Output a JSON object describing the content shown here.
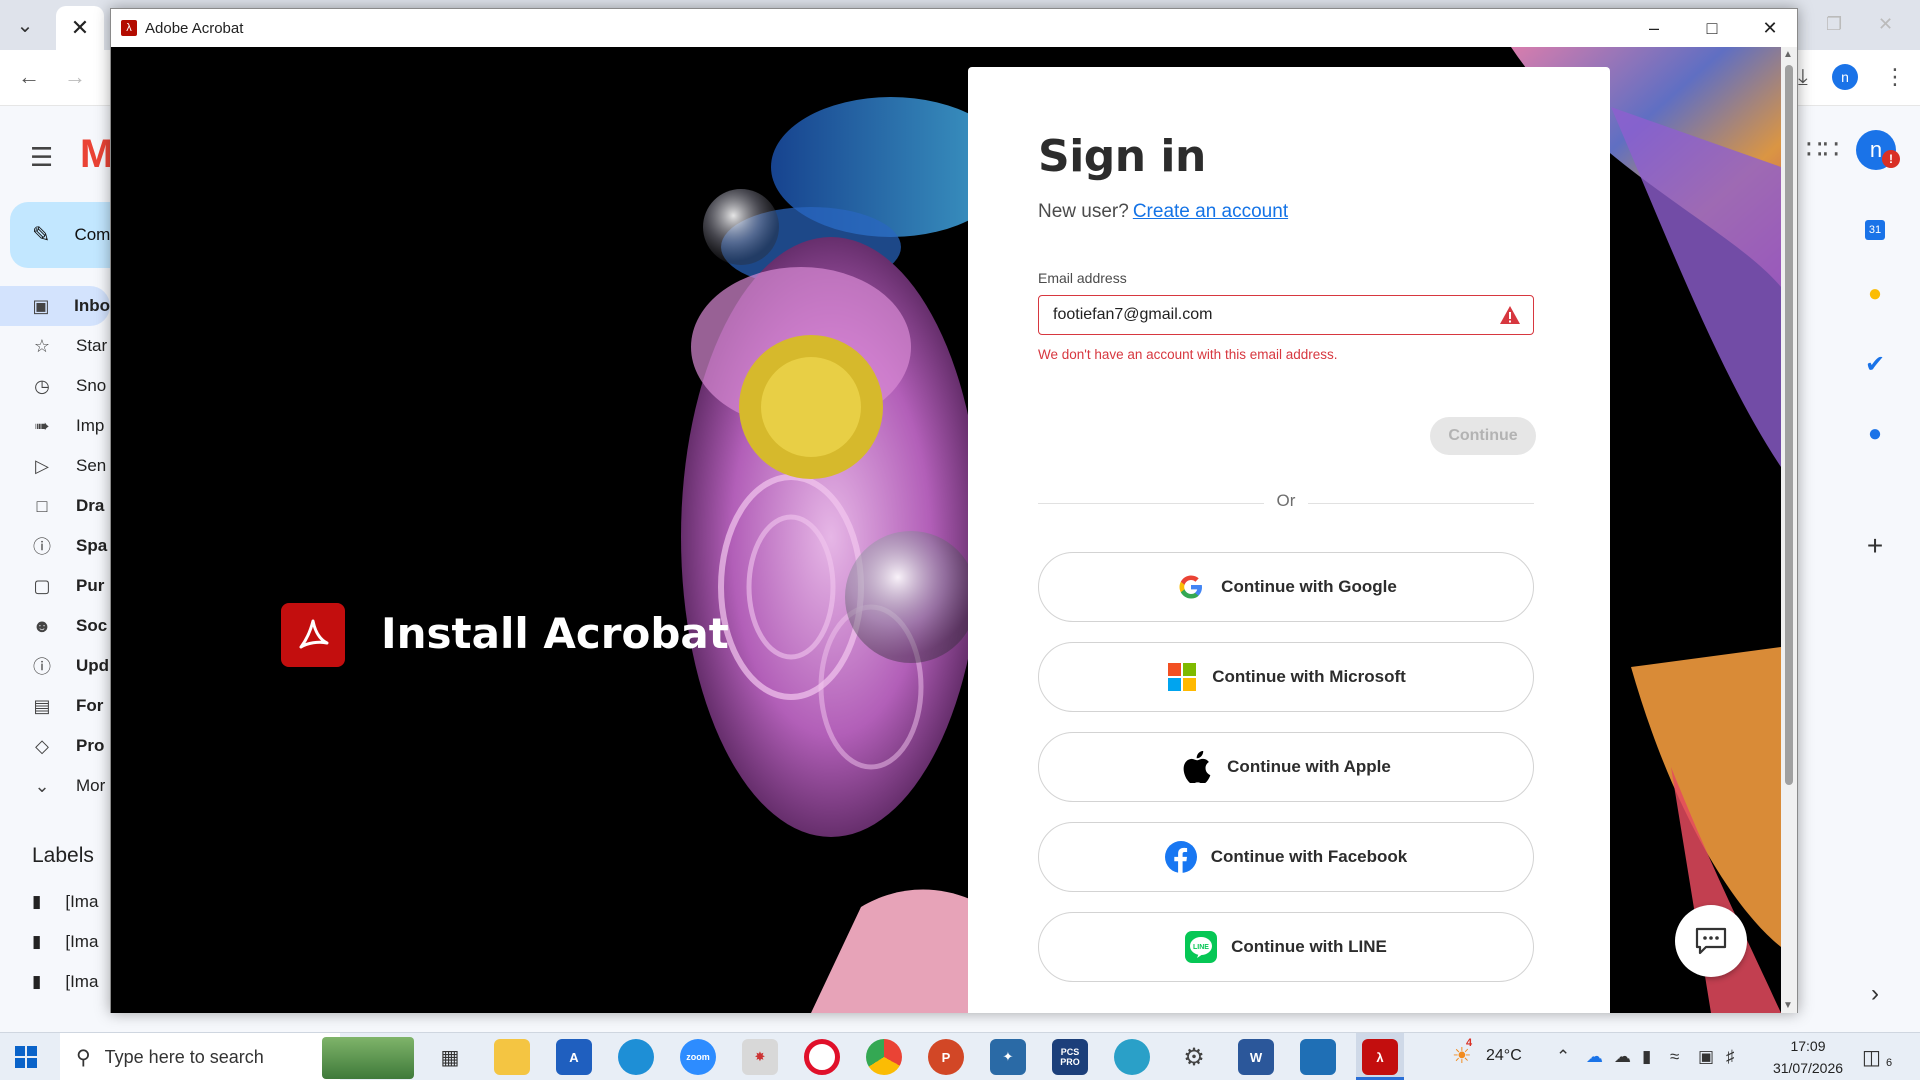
{
  "acrobat": {
    "window_title": "Adobe Acrobat",
    "install_text": "Install Acrobat"
  },
  "signin": {
    "title": "Sign in",
    "new_user_prefix": "New user?",
    "create_account_link": "Create an account",
    "email_label": "Email address",
    "email_value": "footiefan7@gmail.com",
    "error_message": "We don't have an account with this email address.",
    "continue_label": "Continue",
    "or_label": "Or",
    "social_buttons": [
      {
        "label": "Continue with Google",
        "icon": "google-icon"
      },
      {
        "label": "Continue with Microsoft",
        "icon": "microsoft-icon"
      },
      {
        "label": "Continue with Apple",
        "icon": "apple-icon"
      },
      {
        "label": "Continue with Facebook",
        "icon": "facebook-icon"
      },
      {
        "label": "Continue with LINE",
        "icon": "line-icon"
      }
    ]
  },
  "gmail": {
    "compose_label": "Com",
    "nav_items": [
      {
        "label": "Inbo",
        "icon": "inbox-icon"
      },
      {
        "label": "Star",
        "icon": "star-icon"
      },
      {
        "label": "Sno",
        "icon": "clock-icon"
      },
      {
        "label": "Imp",
        "icon": "label-important-icon"
      },
      {
        "label": "Sen",
        "icon": "send-icon"
      },
      {
        "label": "Dra",
        "icon": "draft-icon"
      },
      {
        "label": "Spa",
        "icon": "spam-icon"
      },
      {
        "label": "Pur",
        "icon": "shopping-bag-icon"
      },
      {
        "label": "Soc",
        "icon": "people-icon"
      },
      {
        "label": "Upd",
        "icon": "info-icon"
      },
      {
        "label": "For",
        "icon": "forum-icon"
      },
      {
        "label": "Pro",
        "icon": "tag-icon"
      },
      {
        "label": "Mor",
        "icon": "chevron-down-icon"
      }
    ],
    "labels_title": "Labels",
    "label_items": [
      "[Ima",
      "[Ima",
      "[Ima"
    ],
    "account_initial": "n",
    "calendar_day": "31"
  },
  "browser": {
    "account_initial": "n"
  },
  "taskbar": {
    "search_placeholder": "Type here to search",
    "weather_temp": "24°C",
    "weather_badge": "4",
    "time": "17:09",
    "date": "31/07/2026",
    "notification_count": "6",
    "apps": [
      "task-view",
      "file-explorer",
      "app-a",
      "edge",
      "zoom",
      "paint",
      "opera",
      "chrome",
      "powerpoint-pdf",
      "pen-app",
      "pcs-pro",
      "edge-alt",
      "settings",
      "word",
      "terminal",
      "acrobat"
    ],
    "zoom_label": "zoom",
    "pcs_label": "PCS PRO"
  },
  "colors": {
    "adobe_red": "#c30e0e",
    "error_red": "#d7373f",
    "link_blue": "#1473e6"
  }
}
